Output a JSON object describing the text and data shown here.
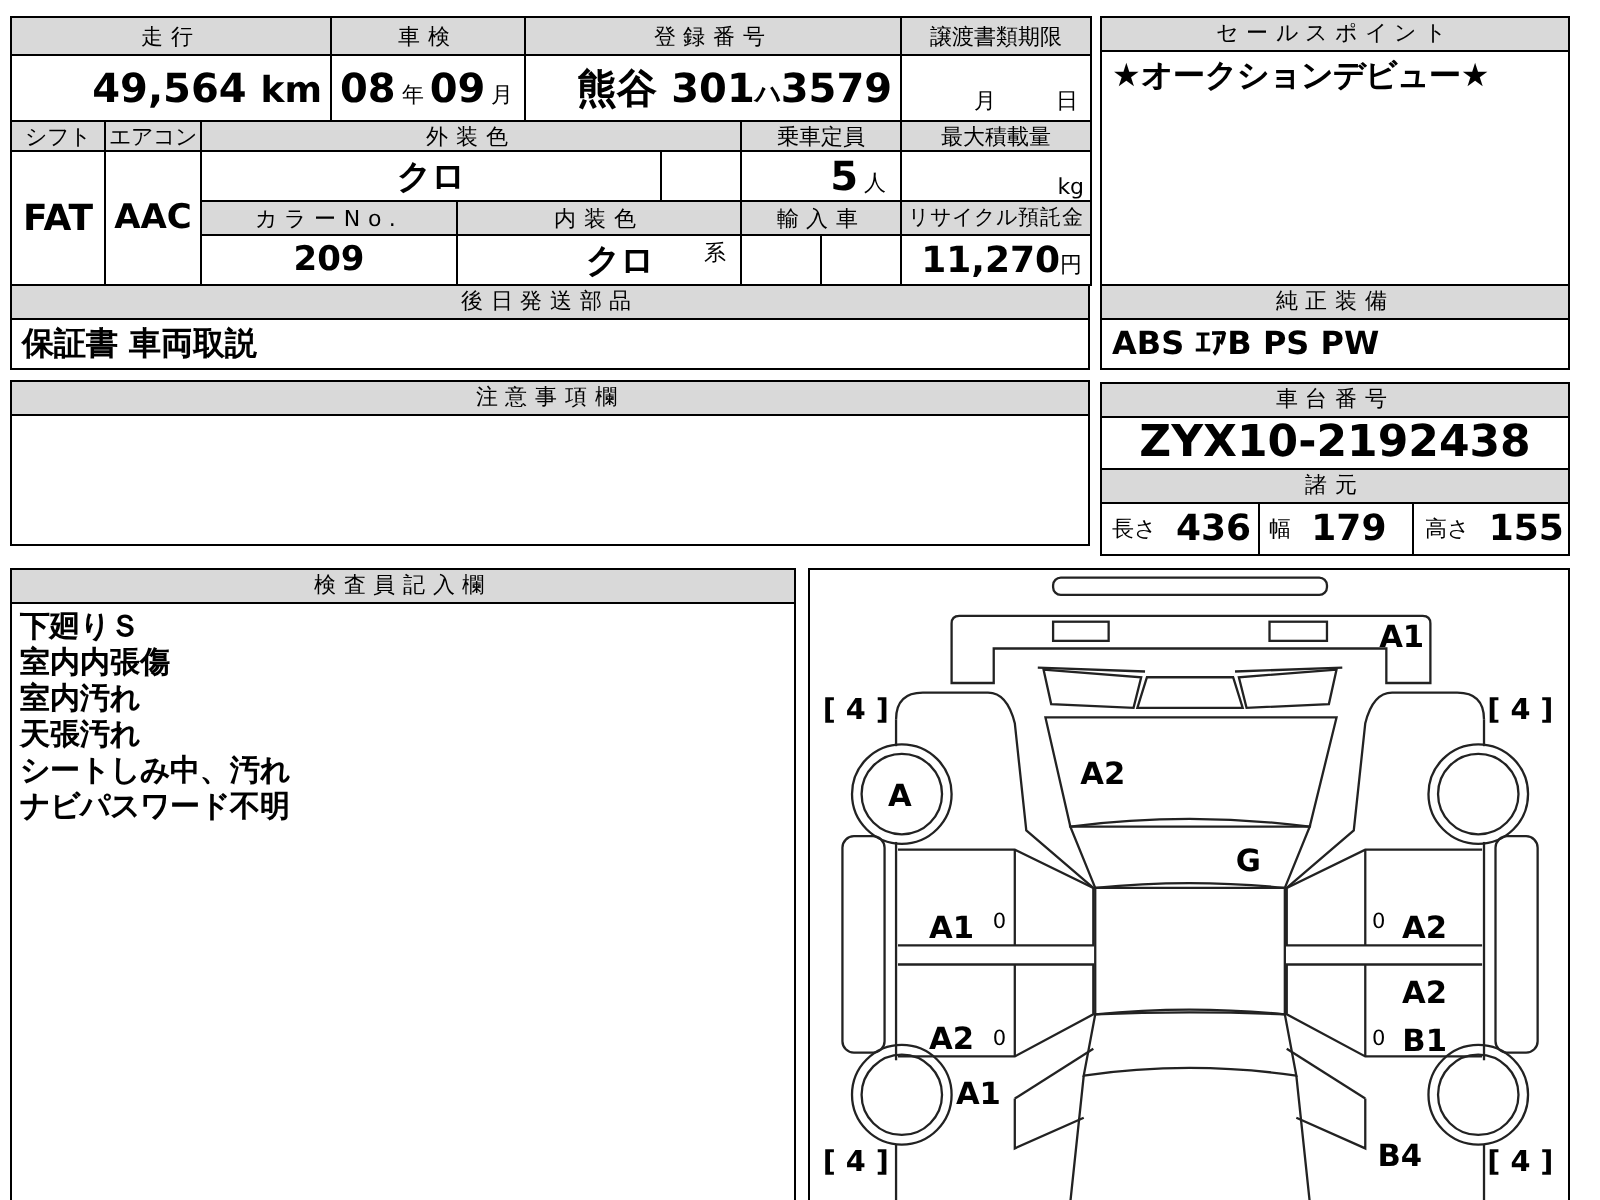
{
  "mileage": {
    "label": "走行",
    "value": "49,564",
    "unit": "km"
  },
  "inspection": {
    "label": "車検",
    "year": "08",
    "year_unit": "年",
    "month": "09",
    "month_unit": "月"
  },
  "registration": {
    "label": "登録番号",
    "area": "熊谷",
    "class": "301",
    "kana": "ハ",
    "number": "3579"
  },
  "transfer_deadline": {
    "label": "譲渡書類期限",
    "month_unit": "月",
    "day_unit": "日"
  },
  "shift": {
    "label": "シフト",
    "value": "FAT"
  },
  "aircon": {
    "label": "エアコン",
    "value": "AAC"
  },
  "exterior_color": {
    "label": "外装色",
    "value": "クロ"
  },
  "capacity": {
    "label": "乗車定員",
    "value": "5",
    "unit": "人"
  },
  "max_load": {
    "label": "最大積載量",
    "unit": "kg"
  },
  "color_no": {
    "label": "カラーNo.",
    "value": "209"
  },
  "interior_color": {
    "label": "内装色",
    "value": "クロ",
    "unit": "系"
  },
  "imported": {
    "label": "輸入車"
  },
  "recycle_fee": {
    "label": "リサイクル預託金",
    "value": "11,270",
    "unit": "円"
  },
  "parts_to_send": {
    "label": "後日発送部品",
    "value": "保証書 車両取説"
  },
  "notes": {
    "label": "注意事項欄"
  },
  "sales_point": {
    "label": "セールスポイント",
    "value": "★オークションデビュー★"
  },
  "equipment": {
    "label": "純正装備",
    "value": "ABS ｴｱB PS PW"
  },
  "chassis": {
    "label": "車台番号",
    "value": "ZYX10-2192438"
  },
  "specs": {
    "label": "諸元",
    "items": [
      {
        "label": "長さ",
        "value": "436"
      },
      {
        "label": "幅",
        "value": "179"
      },
      {
        "label": "高さ",
        "value": "155"
      }
    ]
  },
  "inspector": {
    "label": "検査員記入欄",
    "lines": [
      "下廻りＳ",
      "室内内張傷",
      "室内汚れ",
      "天張汚れ",
      "シートしみ中、汚れ",
      "ナビパスワード不明"
    ]
  },
  "diagram": {
    "tread": [
      "[ 4 ]",
      "[ 4 ]",
      "[ 4 ]",
      "[ 4 ]"
    ],
    "marks": [
      "A1",
      "A",
      "A2",
      "G",
      "A1",
      "0",
      "0",
      "A2",
      "A2",
      "A2",
      "0",
      "0",
      "B1",
      "A1",
      "B4"
    ]
  }
}
